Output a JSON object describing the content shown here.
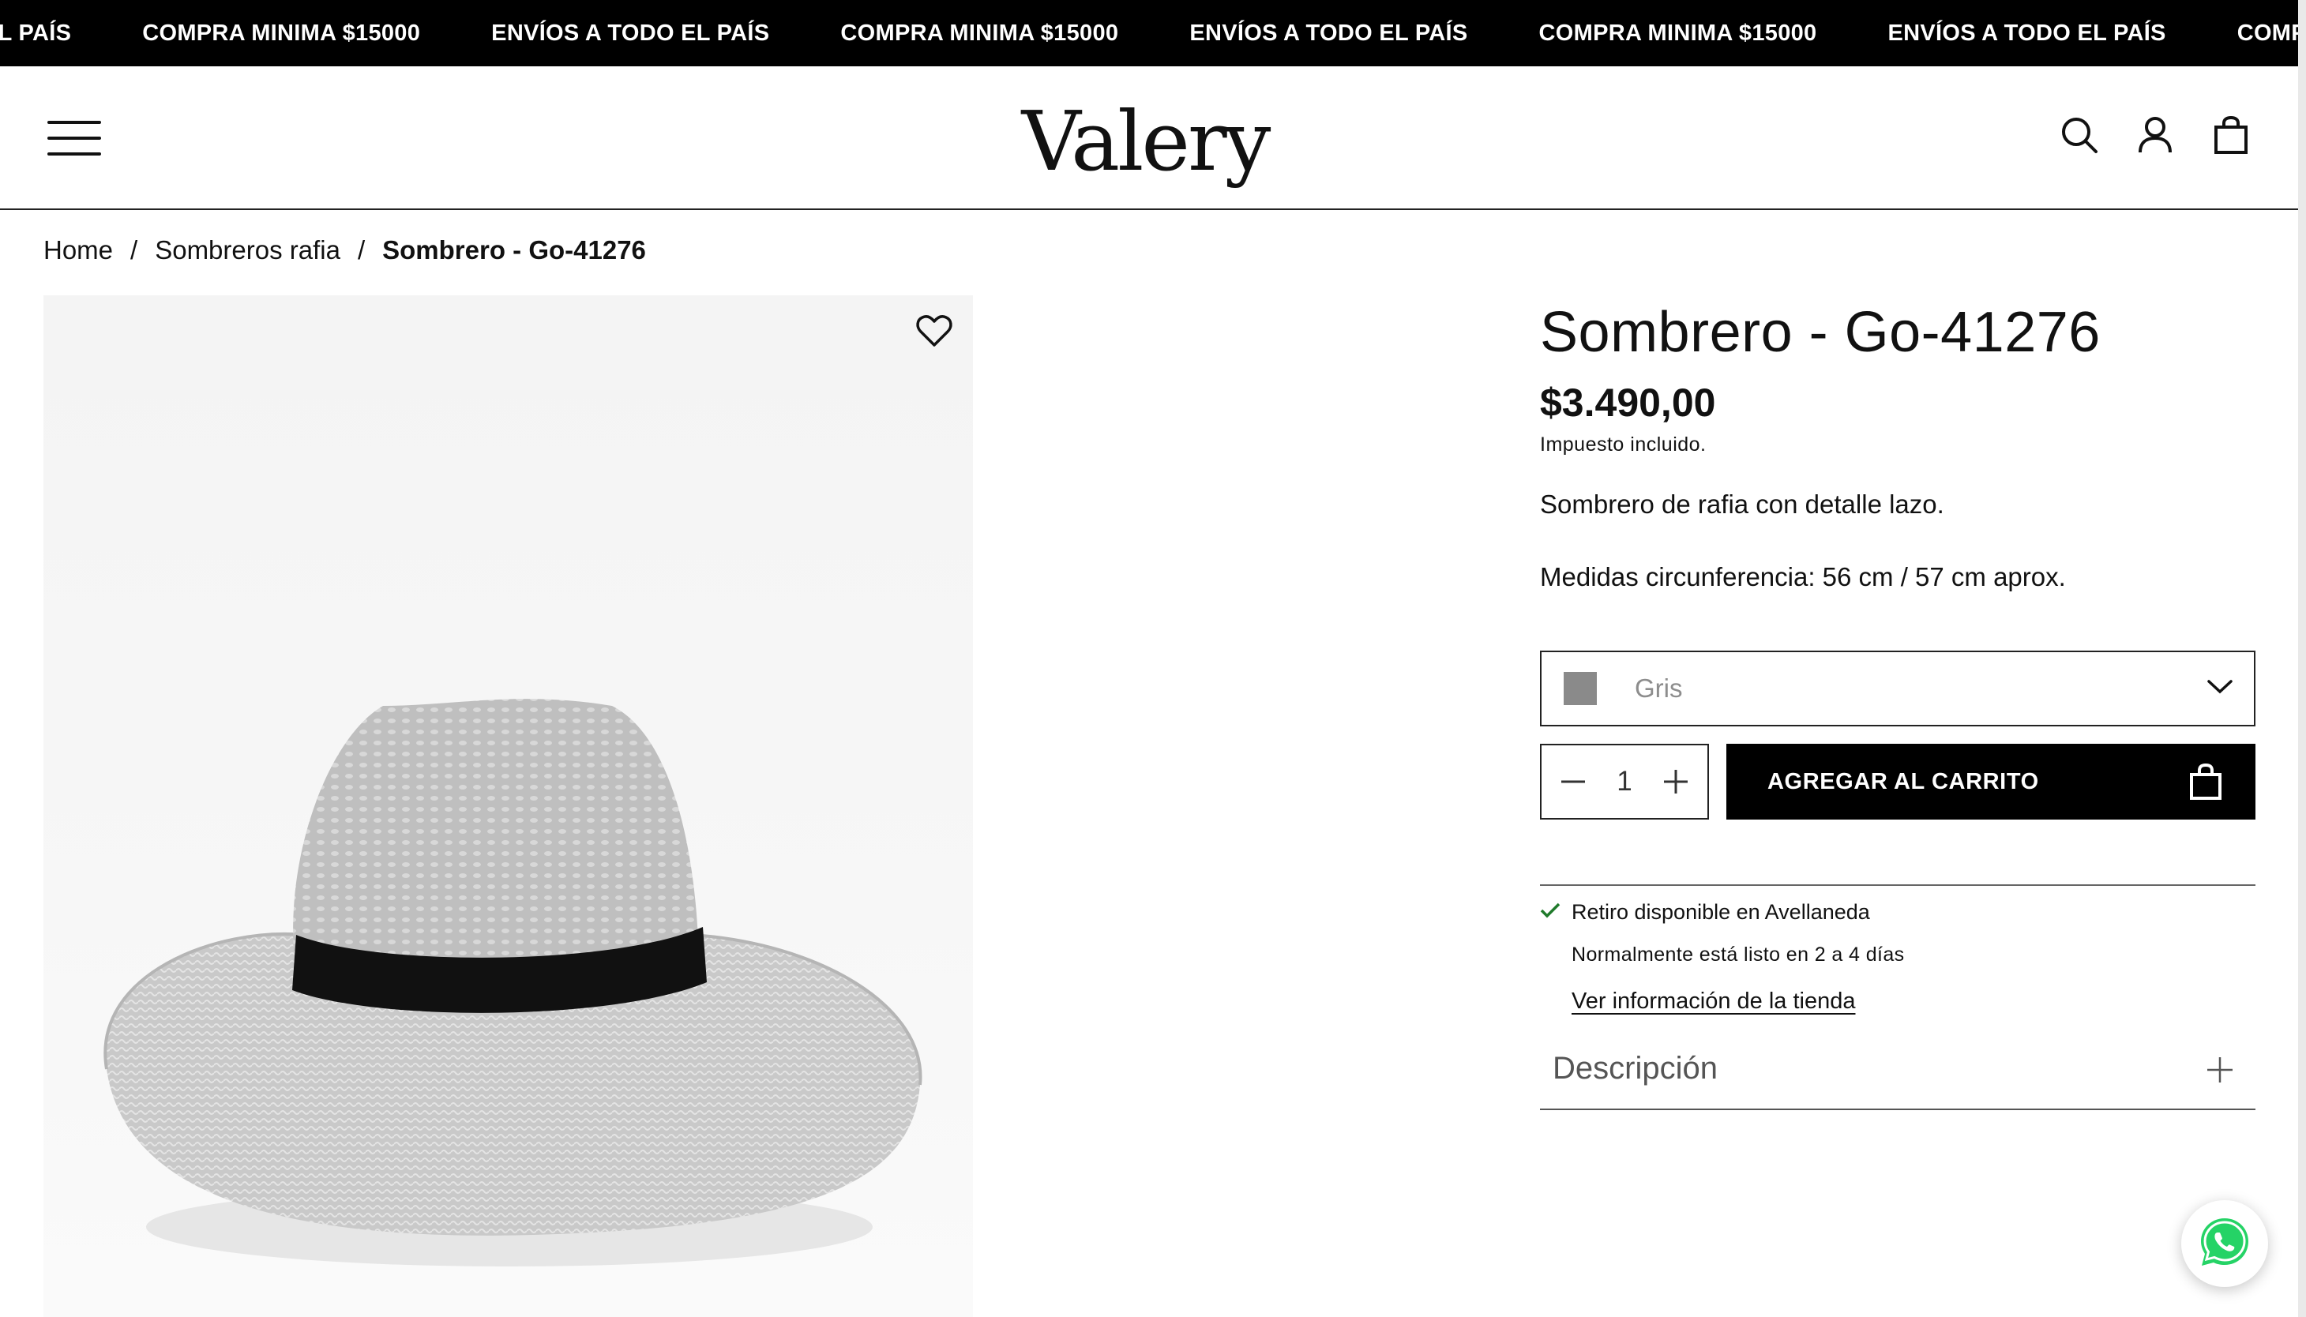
{
  "announcement": {
    "items": [
      "EL PAÍS",
      "COMPRA MINIMA $15000",
      "ENVÍOS A TODO EL PAÍS",
      "COMPRA MINIMA $15000",
      "ENVÍOS A TODO EL PAÍS",
      "COMPRA MINIMA $15000",
      "ENVÍOS A TODO EL PAÍS",
      "COMPRA"
    ]
  },
  "header": {
    "logo": "Valery",
    "icons": [
      "menu-icon",
      "search-icon",
      "account-icon",
      "cart-icon"
    ]
  },
  "breadcrumb": {
    "home": "Home",
    "separator": "/",
    "category": "Sombreros rafia",
    "current": "Sombrero - Go-41276"
  },
  "gallery": {
    "wishlist_icon": "heart-icon"
  },
  "product": {
    "title": "Sombrero - Go-41276",
    "price": "$3.490,00",
    "tax_note": "Impuesto incluido.",
    "description_1": "Sombrero de rafia con detalle lazo.",
    "description_2": "Medidas circunferencia: 56 cm / 57 cm aprox.",
    "variant": {
      "selected": "Gris",
      "swatch_color": "#8a8a8a"
    },
    "quantity": "1",
    "add_to_cart": "AGREGAR AL CARRITO"
  },
  "pickup": {
    "status": "Retiro disponible en Avellaneda",
    "detail": "Normalmente está listo en 2 a 4 días",
    "link": "Ver información de la tienda"
  },
  "accordion": {
    "label": "Descripción"
  },
  "colors": {
    "accent": "#000000",
    "check": "#1f7a2b",
    "whatsapp": "#25D366"
  }
}
